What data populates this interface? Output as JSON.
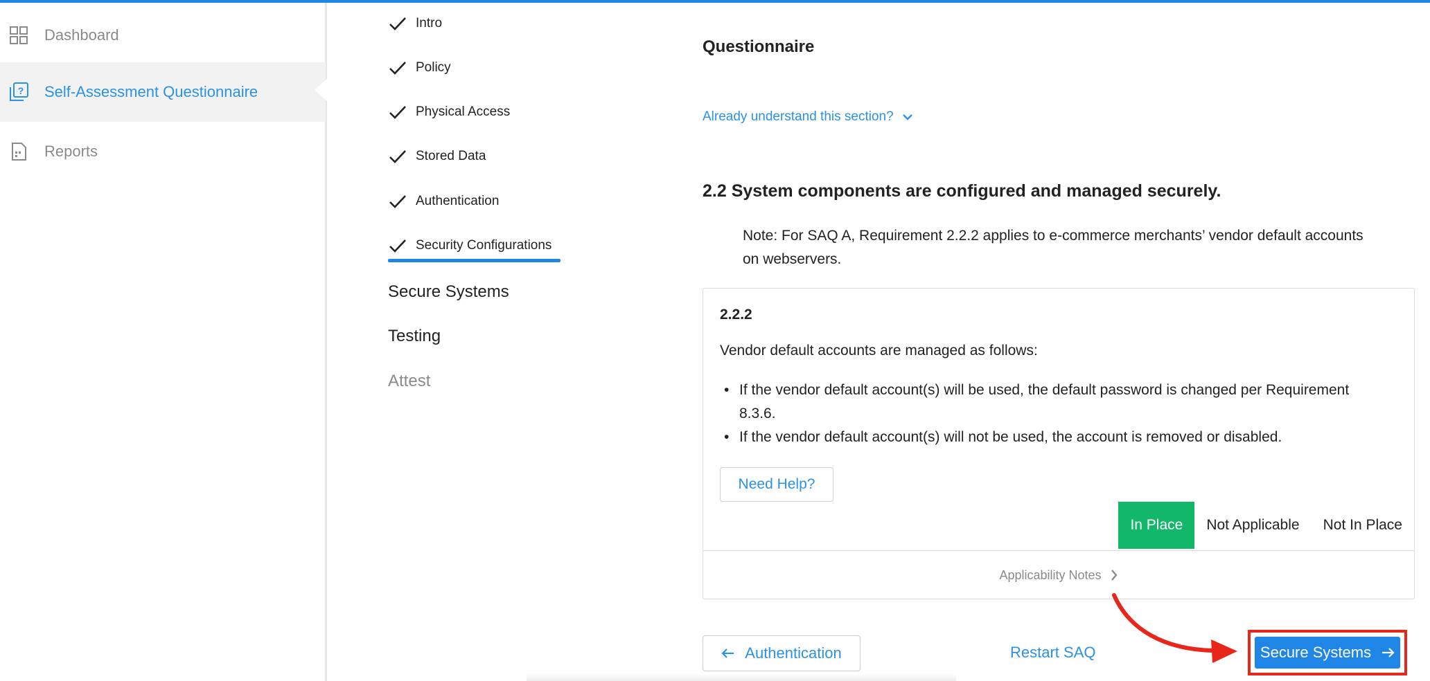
{
  "colors": {
    "accent": "#1f86e6",
    "link": "#2b92e4",
    "success": "#12b76a",
    "highlight": "#e8261a"
  },
  "sidebar": {
    "items": [
      {
        "label": "Dashboard",
        "icon": "grid-icon",
        "active": false
      },
      {
        "label": "Self-Assessment Questionnaire",
        "icon": "questionnaire-icon",
        "active": true
      },
      {
        "label": "Reports",
        "icon": "report-icon",
        "active": false
      }
    ]
  },
  "steps": {
    "completed": [
      "Intro",
      "Policy",
      "Physical Access",
      "Stored Data",
      "Authentication",
      "Security Configurations"
    ],
    "current": "Security Configurations",
    "upcoming": [
      "Secure Systems",
      "Testing"
    ],
    "disabled": [
      "Attest"
    ]
  },
  "main": {
    "title": "Questionnaire",
    "already_understand": "Already understand this section?",
    "section_heading": "2.2 System components are configured and managed securely.",
    "note": "Note: For SAQ A, Requirement 2.2.2 applies to e-commerce merchants’ vendor default accounts on webservers.",
    "card": {
      "number": "2.2.2",
      "description": "Vendor default accounts are managed as follows:",
      "bullets": [
        "If the vendor default account(s) will be used, the default password is changed per Requirement 8.3.6.",
        "If the vendor default account(s) will not be used, the account is removed or disabled."
      ],
      "help_label": "Need Help?",
      "status_options": [
        "In Place",
        "Not Applicable",
        "Not In Place"
      ],
      "selected_status": "In Place",
      "applicability_notes": "Applicability Notes"
    },
    "footer": {
      "back_label": "Authentication",
      "restart_label": "Restart SAQ",
      "next_label": "Secure Systems"
    }
  }
}
